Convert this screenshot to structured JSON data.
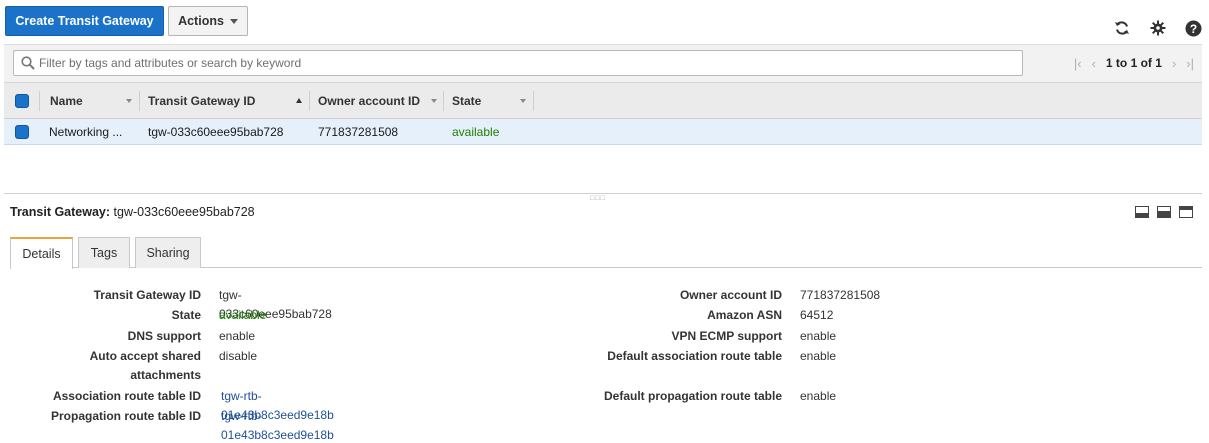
{
  "toolbar": {
    "create_label": "Create Transit Gateway",
    "actions_label": "Actions",
    "icons": [
      "refresh-icon",
      "gear-icon",
      "help-icon"
    ]
  },
  "filter": {
    "placeholder": "Filter by tags and attributes or search by keyword",
    "pager_label": "1 to 1 of 1"
  },
  "table": {
    "columns": [
      "Name",
      "Transit Gateway ID",
      "Owner account ID",
      "State"
    ],
    "rows": [
      {
        "name": "Networking ...",
        "id": "tgw-033c60eee95bab728",
        "owner": "771837281508",
        "state": "available"
      }
    ]
  },
  "detail": {
    "title_label": "Transit Gateway:",
    "title_value": "tgw-033c60eee95bab728",
    "tabs": [
      "Details",
      "Tags",
      "Sharing"
    ],
    "left": [
      {
        "key": "Transit Gateway ID",
        "value": "tgw-033c60eee95bab728"
      },
      {
        "key": "State",
        "value": "available"
      },
      {
        "key": "DNS support",
        "value": "enable"
      },
      {
        "key": "Auto accept shared",
        "key2": "attachments",
        "value": "disable"
      },
      {
        "key": "Association route table ID",
        "value": "tgw-rtb-01e43b8c3eed9e18b"
      },
      {
        "key": "Propagation route table ID",
        "value": "tgw-rtb-01e43b8c3eed9e18b"
      }
    ],
    "right": [
      {
        "key": "Owner account ID",
        "value": "771837281508"
      },
      {
        "key": "Amazon ASN",
        "value": "64512"
      },
      {
        "key": "VPN ECMP support",
        "value": "enable"
      },
      {
        "key": "Default association route table",
        "value": "enable"
      },
      {
        "key": "Default propagation route table",
        "value": "enable"
      }
    ]
  },
  "colors": {
    "primary": "#1a73c9",
    "available": "#1d8102",
    "link": "#1f4f94",
    "active_tab": "#e9a53a"
  }
}
